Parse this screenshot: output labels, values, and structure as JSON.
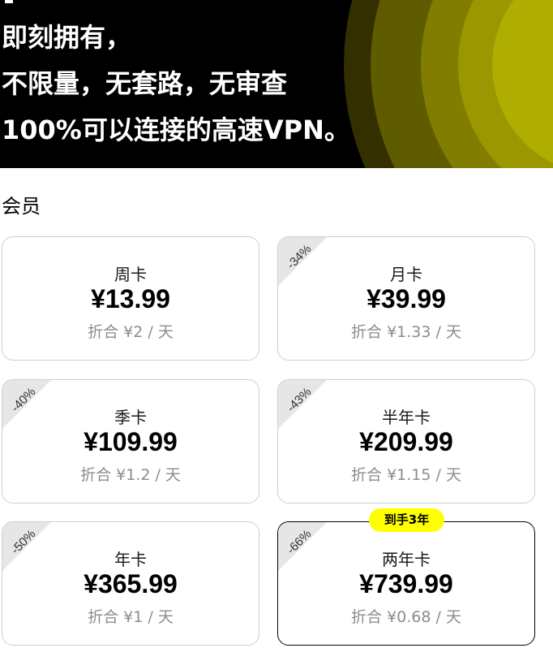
{
  "banner": {
    "line1": "即刻拥有，",
    "line2": "不限量，无套路，无审查",
    "line3": "100%可以连接的高速VPN。"
  },
  "section_title": "会员",
  "colors": {
    "banner_bg": "#000000",
    "ring_colors": [
      "#332f00",
      "#5f5c00",
      "#807d00",
      "#9a9700",
      "#afad00"
    ],
    "badge_bg": "#ffff00",
    "card_border": "#cfcfcf",
    "selected_border": "#000000",
    "daily_text": "#8c8c8c"
  },
  "plans": [
    {
      "name": "周卡",
      "price": "¥13.99",
      "daily": "折合 ¥2 / 天",
      "discount": ""
    },
    {
      "name": "月卡",
      "price": "¥39.99",
      "daily": "折合 ¥1.33 / 天",
      "discount": "-34%"
    },
    {
      "name": "季卡",
      "price": "¥109.99",
      "daily": "折合 ¥1.2 / 天",
      "discount": "-40%"
    },
    {
      "name": "半年卡",
      "price": "¥209.99",
      "daily": "折合 ¥1.15 / 天",
      "discount": "-43%"
    },
    {
      "name": "年卡",
      "price": "¥365.99",
      "daily": "折合 ¥1 / 天",
      "discount": "-50%"
    },
    {
      "name": "两年卡",
      "price": "¥739.99",
      "daily": "折合 ¥0.68 / 天",
      "discount": "-66%",
      "badge": "到手3年",
      "selected": true
    }
  ]
}
